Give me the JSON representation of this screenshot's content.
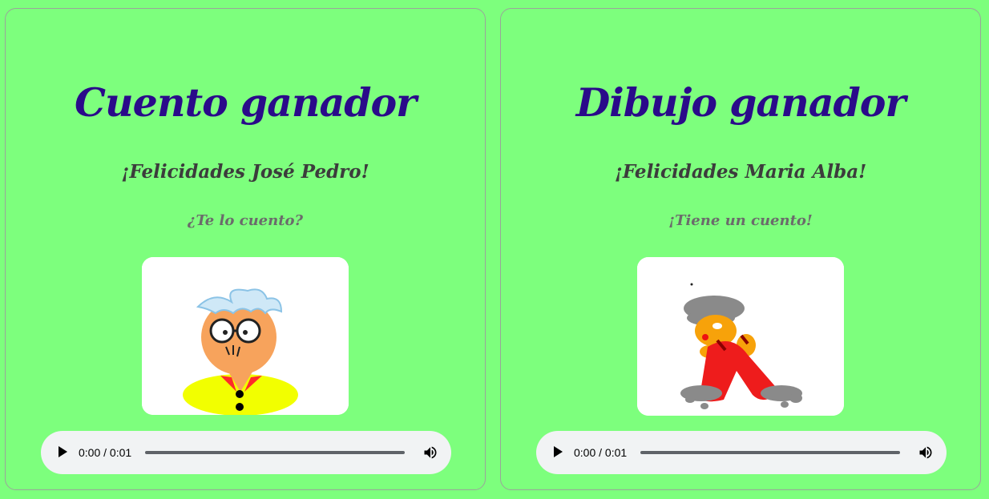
{
  "cards": [
    {
      "title": "Cuento ganador",
      "congrats": "¡Felicidades José Pedro!",
      "subtitle": "¿Te lo cuento?",
      "audio": {
        "time": "0:00 / 0:01",
        "progress": 0
      },
      "image": "grandpa-with-glasses-drawing"
    },
    {
      "title": "Dibujo ganador",
      "congrats": "¡Felicidades Maria Alba!",
      "subtitle": "¡Tiene un cuento!",
      "audio": {
        "time": "0:00 / 0:01",
        "progress": 0
      },
      "image": "child-drawing-figure-in-red"
    }
  ],
  "colors": {
    "background": "#7dff7d",
    "title": "#2a0a8a",
    "congrats": "#3c3c3c",
    "subtitle": "#6b6b6b"
  }
}
